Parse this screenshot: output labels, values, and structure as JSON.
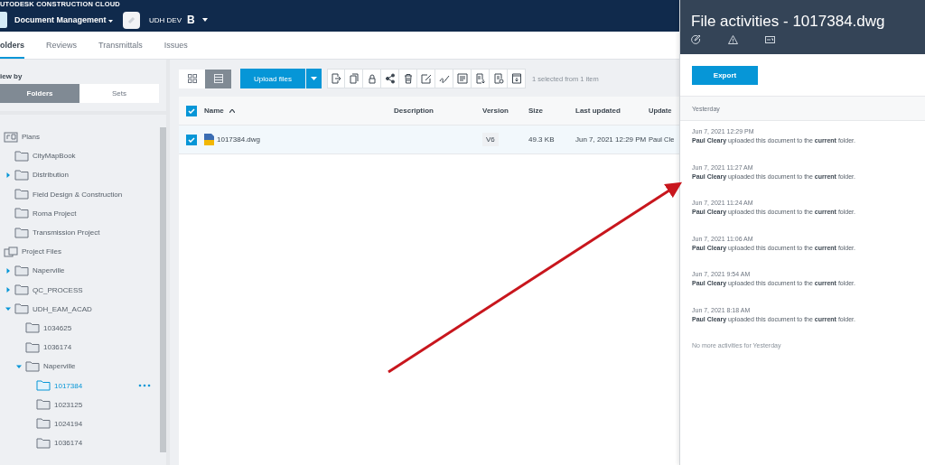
{
  "header": {
    "brand": "UTODESK CONSTRUCTION CLOUD",
    "module": "Document Management",
    "project": "UDH DEV",
    "project_badge": "B"
  },
  "nav_tabs": [
    {
      "label": "olders",
      "selected": true
    },
    {
      "label": "Reviews",
      "selected": false
    },
    {
      "label": "Transmittals",
      "selected": false
    },
    {
      "label": "Issues",
      "selected": false
    }
  ],
  "sidebar": {
    "view_by_label": "iew by",
    "view_toggle": [
      {
        "label": "Folders",
        "selected": true
      },
      {
        "label": "Sets",
        "selected": false
      }
    ],
    "tree": [
      {
        "label": "Plans",
        "kind": "plans",
        "selected": false,
        "children": [
          {
            "label": "CityMapBook",
            "kind": "folder",
            "selected": false
          },
          {
            "label": "Distribution",
            "kind": "folder",
            "selected": false,
            "expanded": false
          },
          {
            "label": "Field Design & Construction",
            "kind": "folder",
            "selected": false
          },
          {
            "label": "Roma Project",
            "kind": "folder",
            "selected": false
          },
          {
            "label": "Transmission Project",
            "kind": "folder",
            "selected": false
          }
        ]
      },
      {
        "label": "Project Files",
        "kind": "files",
        "selected": false,
        "children": [
          {
            "label": "Naperville",
            "kind": "folder",
            "selected": false,
            "expanded": false
          },
          {
            "label": "QC_PROCESS",
            "kind": "folder",
            "selected": false,
            "expanded": false
          },
          {
            "label": "UDH_EAM_ACAD",
            "kind": "folder",
            "selected": false,
            "expanded": true,
            "children": [
              {
                "label": "1034625",
                "kind": "folder",
                "selected": false
              },
              {
                "label": "1036174",
                "kind": "folder",
                "selected": false
              },
              {
                "label": "Naperville",
                "kind": "folder",
                "selected": false,
                "expanded": true,
                "children": [
                  {
                    "label": "1017384",
                    "kind": "folder",
                    "selected": true
                  },
                  {
                    "label": "1023125",
                    "kind": "folder",
                    "selected": false
                  },
                  {
                    "label": "1024194",
                    "kind": "folder",
                    "selected": false
                  },
                  {
                    "label": "1036174",
                    "kind": "folder",
                    "selected": false
                  }
                ]
              }
            ]
          }
        ]
      }
    ]
  },
  "toolbar": {
    "views": [
      {
        "kind": "grid",
        "selected": false
      },
      {
        "kind": "list",
        "selected": true
      }
    ],
    "upload_label": "Upload files",
    "actions": [
      {
        "kind": "move"
      },
      {
        "kind": "copy"
      },
      {
        "kind": "lock"
      },
      {
        "kind": "share"
      },
      {
        "kind": "delete"
      },
      {
        "kind": "edit"
      },
      {
        "kind": "sign"
      },
      {
        "kind": "notes"
      },
      {
        "kind": "export"
      },
      {
        "kind": "report"
      },
      {
        "kind": "archive"
      }
    ],
    "selection_text": "1 selected from 1 item"
  },
  "table": {
    "all_checked": true,
    "columns": [
      "Name",
      "Description",
      "Version",
      "Size",
      "Last updated",
      "Update"
    ],
    "sort_ascending": true,
    "rows": [
      {
        "checked": true,
        "name": "1017384.dwg",
        "description": "",
        "version": "V6",
        "size": "49.3 KB",
        "last_updated": "Jun 7, 2021 12:29 PM",
        "updated_by": "Paul Cle"
      }
    ]
  },
  "panel": {
    "title": "File activities - 1017384.dwg",
    "icons": [
      {
        "kind": "markup"
      },
      {
        "kind": "issue"
      },
      {
        "kind": "rfi"
      }
    ],
    "export_label": "Export",
    "group_label": "Yesterday",
    "activities": [
      {
        "time": "Jun 7, 2021 12:29 PM",
        "text": "**Paul Cleary** uploaded this document to the **current** folder."
      },
      {
        "time": "Jun 7, 2021 11:27 AM",
        "text": "**Paul Cleary** uploaded this document to the **current** folder."
      },
      {
        "time": "Jun 7, 2021 11:24 AM",
        "text": "**Paul Cleary** uploaded this document to the **current** folder."
      },
      {
        "time": "Jun 7, 2021 11:06 AM",
        "text": "**Paul Cleary** uploaded this document to the **current** folder."
      },
      {
        "time": "Jun 7, 2021 9:54 AM",
        "text": "**Paul Cleary** uploaded this document to the **current** folder."
      },
      {
        "time": "Jun 7, 2021 8:18 AM",
        "text": "**Paul Cleary** uploaded this document to the **current** folder."
      }
    ],
    "end_note": "No more activities for Yesterday"
  }
}
